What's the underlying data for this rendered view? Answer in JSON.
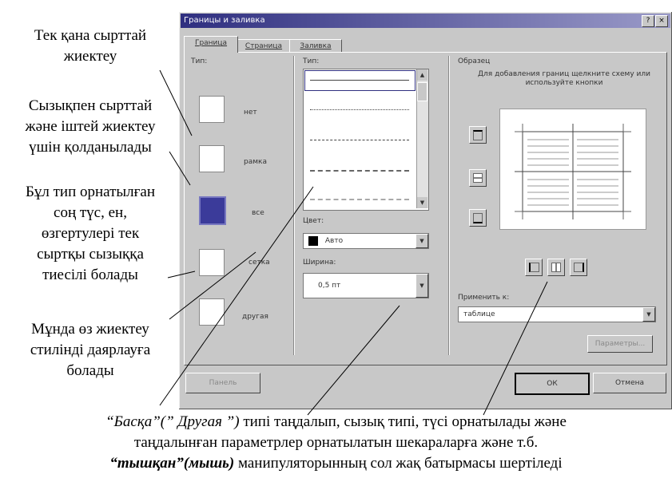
{
  "annotations": {
    "a1": "Тек қана сырттай жиектеу",
    "a2_l1": "Сызықпен сырттай",
    "a2_l2": "және іштей жиектеу",
    "a2_l3": "үшін қолданылады",
    "a3_l1": "Бұл тип орнатылған",
    "a3_l2": "соң түс, ен,",
    "a3_l3": "өзгертулері тек",
    "a3_l4": "сыртқы сызыққа",
    "a3_l5": "тиесілі болады",
    "a4_l1": "Мұнда өз жиектеу",
    "a4_l2": "стилінді даярлауға",
    "a4_l3": "болады",
    "a1_l1": "Тек қана сырттай",
    "a1_l2": "жиектеу"
  },
  "caption": {
    "line1_italic": "“Басқа”(” Другая ”)",
    "line1_rest": " типі таңдалып, сызық типі, түсі орнатылады және",
    "line2": "таңдалынған параметрлер орнатылатын шекараларға және т.б.",
    "line3_bold": "“тышқан”(мышь)",
    "line3_rest": " манипуляторынның сол жақ батырмасы шертіледі"
  },
  "dialog": {
    "title": "Границы и заливка",
    "help_btn": "?",
    "close_btn": "×",
    "tabs": [
      "Граница",
      "Страница",
      "Заливка"
    ],
    "type_label": "Тип:",
    "types": [
      "нет",
      "рамка",
      "все",
      "сетка",
      "другая"
    ],
    "style_label": "Тип:",
    "color_label": "Цвет:",
    "color_value": "Авто",
    "width_label": "Ширина:",
    "width_value": "0,5 пт",
    "preview_label": "Образец",
    "preview_hint": "Для добавления границ щелкните схему или используйте кнопки",
    "apply_label": "Применить к:",
    "apply_value": "таблице",
    "params_btn": "Параметры...",
    "panel_btn": "Панель",
    "ok_btn": "ОК",
    "cancel_btn": "Отмена"
  }
}
